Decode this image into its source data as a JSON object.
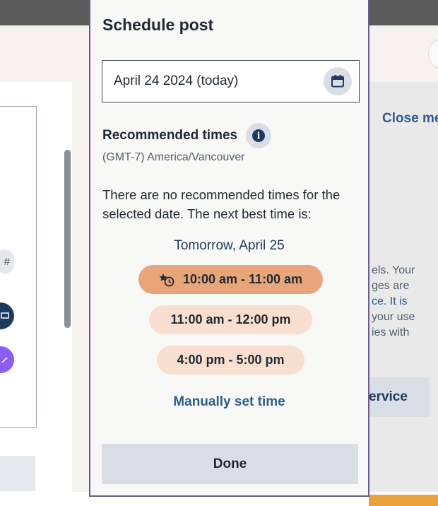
{
  "background": {
    "close_menu": "Close me",
    "side_text": [
      "els. Your",
      "ges are",
      "ce. It is",
      "your use",
      "ies with"
    ],
    "service_button": "ervice",
    "hash_chip": "#"
  },
  "modal": {
    "title": "Schedule post",
    "date_value": "April 24 2024 (today)",
    "calendar_icon": "calendar-icon",
    "recommended_title": "Recommended times",
    "info_icon": "info-icon",
    "timezone": "(GMT-7) America/Vancouver",
    "message": "There are no recommended times for the selected date. The next best time is:",
    "next_date": "Tomorrow, April 25",
    "slots": [
      {
        "label": "10:00 am - 11:00 am",
        "selected": true,
        "icon": "star-clock-icon"
      },
      {
        "label": "11:00 am - 12:00 pm",
        "selected": false
      },
      {
        "label": "4:00 pm - 5:00 pm",
        "selected": false
      }
    ],
    "manual_link": "Manually set time",
    "done_button": "Done"
  },
  "colors": {
    "accent_selected": "#e9a57a",
    "accent_slot": "#f9dfcf",
    "link": "#2f5c8f",
    "modal_border": "#6b5b95"
  }
}
